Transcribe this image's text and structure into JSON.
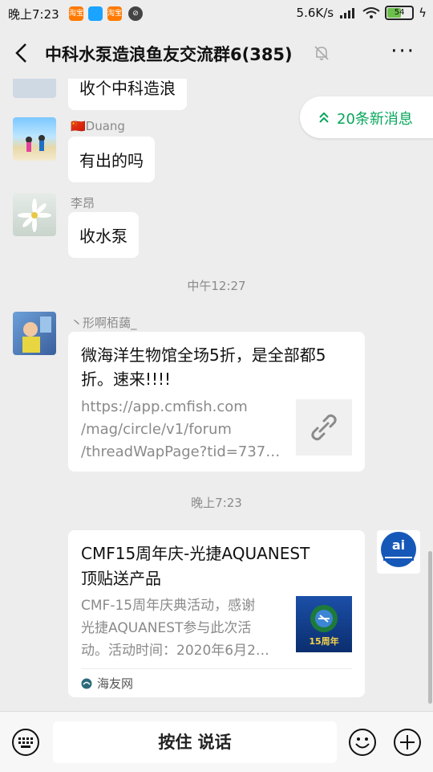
{
  "status_bar": {
    "time": "晚上7:23",
    "app_icons": [
      {
        "name": "taobao-icon",
        "label": "淘宝",
        "color": "#ff7a00"
      },
      {
        "name": "app-blue-icon",
        "label": "",
        "color": "#1aa3ff"
      },
      {
        "name": "taobao-icon-2",
        "label": "淘宝",
        "color": "#ff7a00"
      }
    ],
    "network_speed": "5.6K/s",
    "battery": "54",
    "battery_level": 0.54
  },
  "header": {
    "title": "中科水泵造浪鱼友交流群6(385)",
    "more_label": "···"
  },
  "new_messages": {
    "label": "20条新消息",
    "icon": "double-chevron-up-icon",
    "color": "#07a65c"
  },
  "messages": [
    {
      "type": "text",
      "sender": "",
      "text": "收个中科造浪"
    },
    {
      "type": "text",
      "sender": "🇨🇳Duang",
      "text": "有出的吗"
    },
    {
      "type": "text",
      "sender": "李昂",
      "text": "收水泵"
    },
    {
      "type": "time",
      "text": "中午12:27"
    },
    {
      "type": "link",
      "sender": "丶形啊栢藹_",
      "title": "微海洋生物馆全场5折，是全部都5折。速来!!!!",
      "url_lines": [
        "https://app.cmfish.com",
        "/mag/circle/v1/forum",
        "/threadWapPage?tid=737…"
      ],
      "icon": "link-icon"
    },
    {
      "type": "time",
      "text": "晚上7:23"
    },
    {
      "type": "article",
      "sender": "self",
      "title_lines": [
        "CMF15周年庆-光捷AQUANEST",
        "顶贴送产品"
      ],
      "desc_lines": [
        "CMF-15周年庆典活动，感谢",
        "光捷AQUANEST参与此次活",
        "动。活动时间：2020年6月2…"
      ],
      "thumb_text": "15周年",
      "source": "海友网"
    }
  ],
  "bottom_bar": {
    "talk_label": "按住 说话"
  },
  "colors": {
    "background": "#ededed",
    "bubble": "#ffffff",
    "accent_green": "#07a65c"
  }
}
